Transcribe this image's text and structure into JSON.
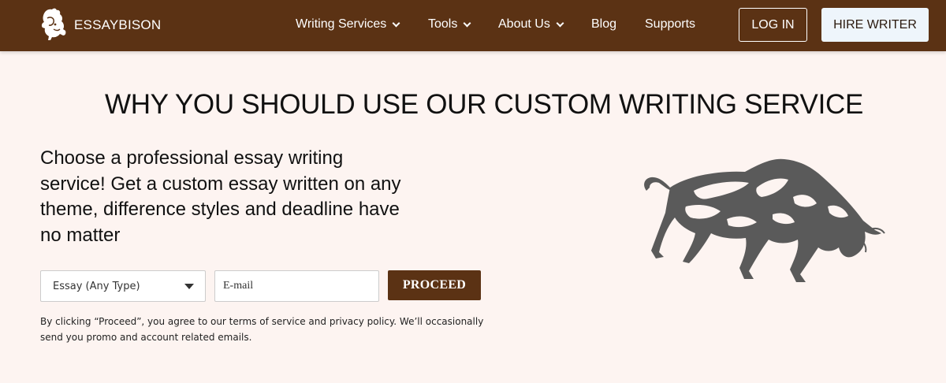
{
  "header": {
    "logo_text": "ESSAYBISON",
    "nav": [
      {
        "label": "Writing Services",
        "has_dropdown": true
      },
      {
        "label": "Tools",
        "has_dropdown": true
      },
      {
        "label": "About Us",
        "has_dropdown": true
      },
      {
        "label": "Blog",
        "has_dropdown": false
      },
      {
        "label": "Supports",
        "has_dropdown": false
      }
    ],
    "login_label": "LOG IN",
    "hire_label": "HIRE WRITER"
  },
  "main": {
    "headline": "WHY YOU SHOULD USE OUR CUSTOM WRITING SERVICE",
    "lead": "Choose a professional essay writing service! Get a custom essay written on any theme, difference styles and deadline have no matter",
    "form": {
      "type_selected": "Essay (Any Type)",
      "email_placeholder": "E-mail",
      "proceed_label": "PROCEED"
    },
    "disclaimer": "By clicking “Proceed”, you agree to our terms of service and privacy policy. We’ll occasionally send you promo and account related emails."
  },
  "colors": {
    "header_bg": "#5b3214",
    "page_bg": "#fdf4f1",
    "accent": "#5b3214",
    "hire_button_bg": "#eef5fb"
  },
  "icons": [
    "bison-logo-icon",
    "chevron-down-icon",
    "caret-down-icon",
    "bison-illustration"
  ]
}
